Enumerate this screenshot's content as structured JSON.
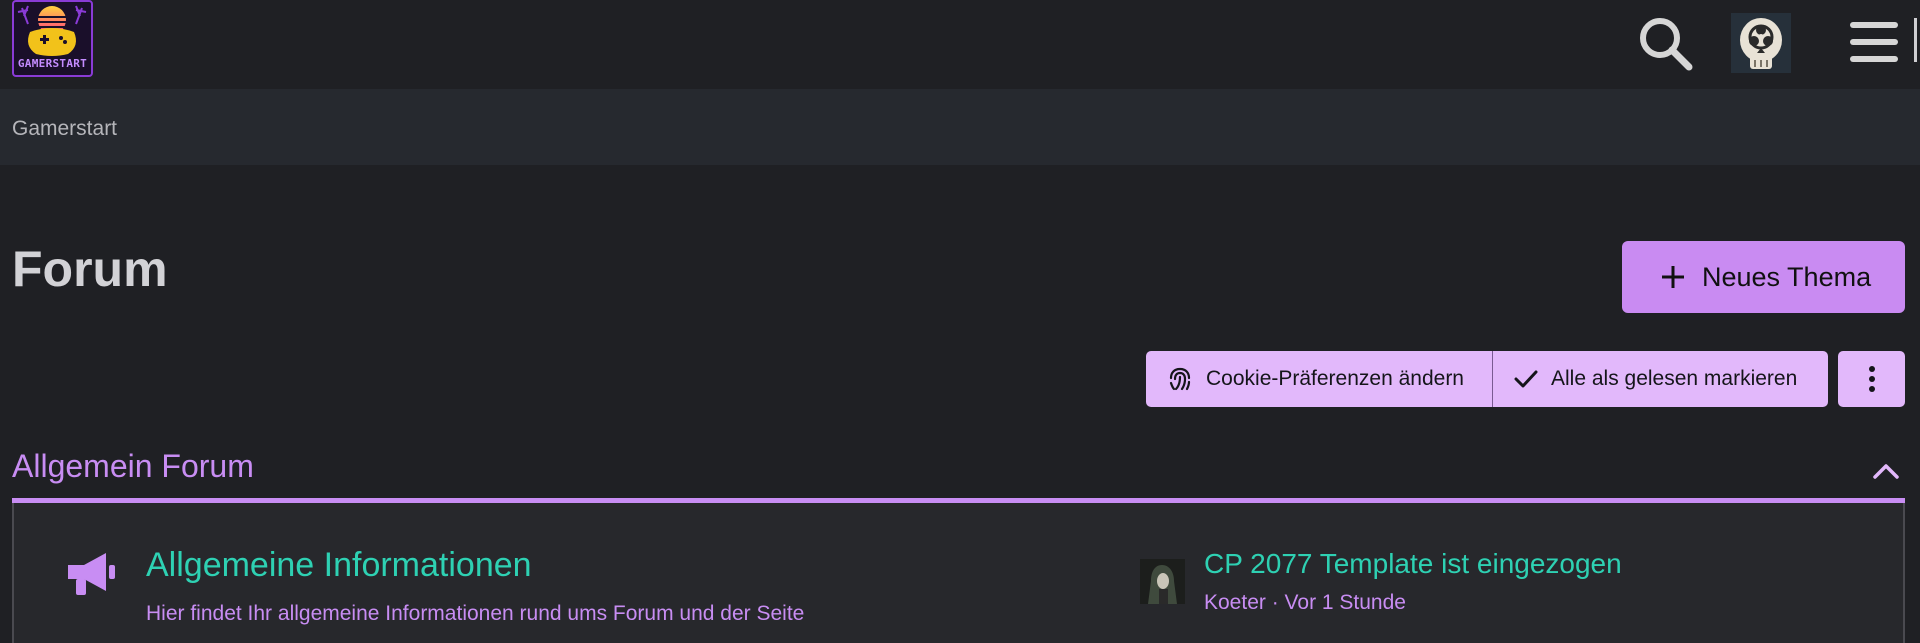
{
  "header": {
    "logo_text": "GAMERSTART",
    "search_icon": "search-icon",
    "avatar_icon": "biohazard-skull-avatar",
    "menu_icon": "hamburger-menu-icon"
  },
  "breadcrumb": {
    "items": [
      "Gamerstart"
    ]
  },
  "page": {
    "title": "Forum",
    "new_topic_label": "Neues Thema"
  },
  "actions": {
    "cookie_label": "Cookie-Präferenzen ändern",
    "mark_read_label": "Alle als gelesen markieren",
    "more_icon": "vertical-ellipsis-icon"
  },
  "category": {
    "title": "Allgemein Forum",
    "boards": [
      {
        "name": "Allgemeine Informationen",
        "description": "Hier findet Ihr allgemeine Informationen rund ums Forum und der Seite",
        "icon": "megaphone-icon",
        "last_post": {
          "title": "CP 2077 Template ist eingezogen",
          "author": "Koeter",
          "separator": " · ",
          "time": "Vor 1 Stunde"
        }
      }
    ]
  },
  "colors": {
    "background": "#1f2024",
    "breadcrumb_bar": "#26292f",
    "accent_purple": "#c98bf2",
    "action_bg": "#e2b8fb",
    "link_teal": "#2ed1b3",
    "section_purple": "#c88df3"
  }
}
